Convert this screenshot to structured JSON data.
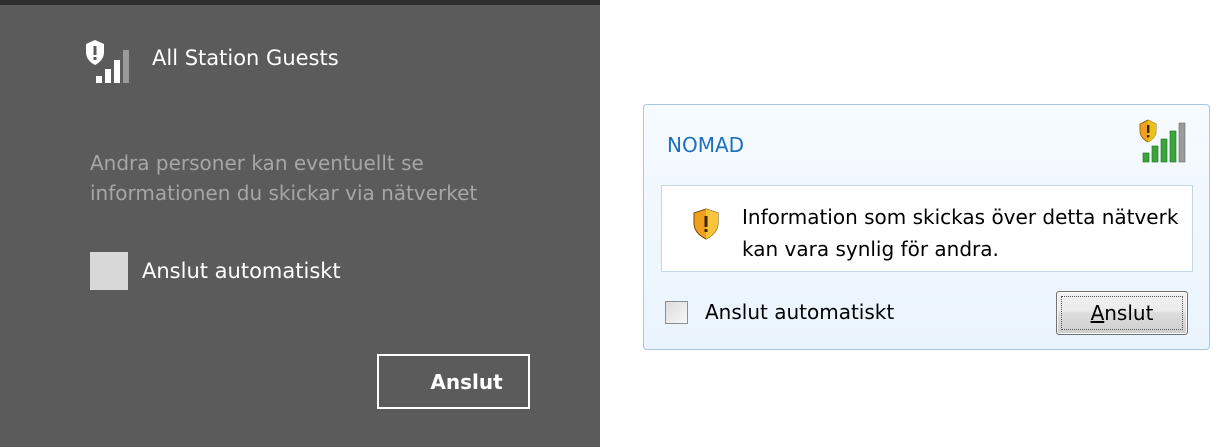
{
  "win8": {
    "network_name": "All Station Guests",
    "signal_icon": "secured-wifi-signal-icon",
    "warning_text": "Andra personer kan eventuellt se informationen du skickar via nätverket",
    "auto_connect_label": "Anslut automatiskt",
    "auto_connect_checked": false,
    "connect_button_label": "Anslut",
    "colors": {
      "background": "#5b5b5b",
      "text": "#ffffff",
      "muted_text": "#a6a6a6"
    }
  },
  "win7": {
    "network_name": "NOMAD",
    "signal_icon": "secured-wifi-signal-icon",
    "warning_icon": "security-shield-warning-icon",
    "warning_text": "Information som skickas över detta nätverk kan vara synlig för andra.",
    "auto_connect_label": "Anslut automatiskt",
    "auto_connect_checked": false,
    "connect_button_label": "Anslut",
    "colors": {
      "title": "#1e6fbf",
      "border": "#a9c6e3",
      "signal_green": "#3aa53a",
      "shield_orange": "#f0a01e"
    }
  }
}
